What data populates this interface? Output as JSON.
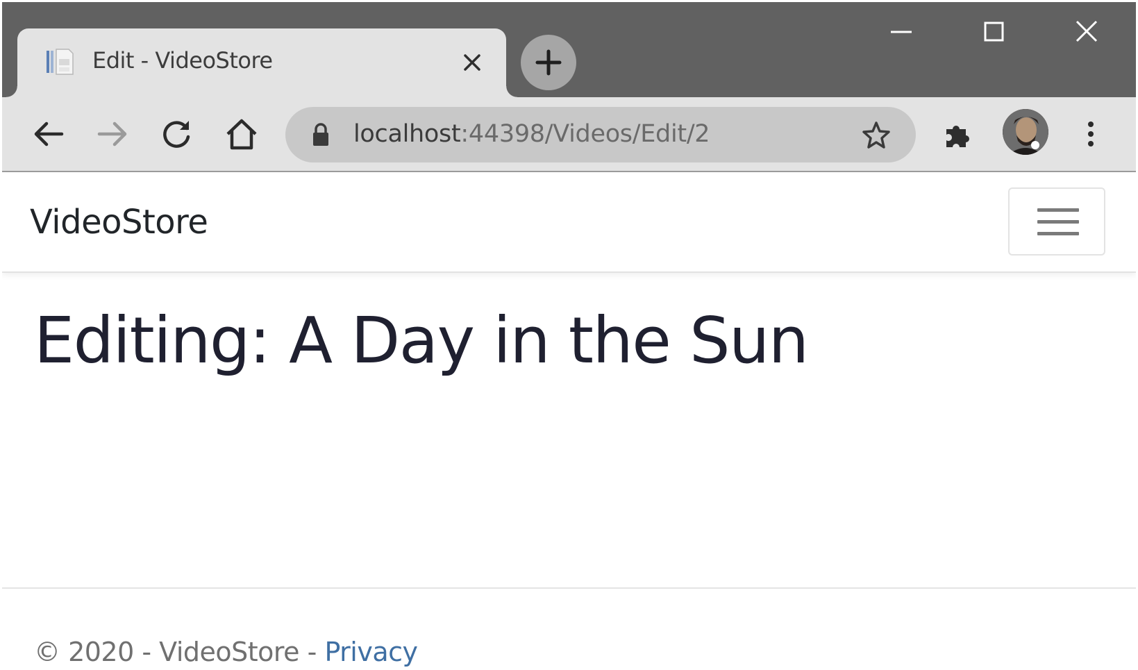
{
  "window": {
    "tab_title": "Edit - VideoStore"
  },
  "toolbar": {
    "url_host": "localhost",
    "url_path": ":44398/Videos/Edit/2"
  },
  "navbar": {
    "brand": "VideoStore"
  },
  "main": {
    "heading": "Editing: A Day in the Sun"
  },
  "footer": {
    "text": "© 2020 - VideoStore - ",
    "privacy_link": "Privacy"
  },
  "icons": {
    "tab_favicon": "document-icon",
    "tab_close": "close-icon",
    "new_tab": "plus-icon",
    "minimize": "minimize-icon",
    "maximize": "maximize-icon",
    "close_window": "close-icon",
    "back": "arrow-left-icon",
    "forward": "arrow-right-icon",
    "reload": "reload-icon",
    "home": "home-icon",
    "lock": "lock-icon",
    "bookmark": "star-icon",
    "extensions": "puzzle-icon",
    "profile": "avatar",
    "menu": "kebab-icon",
    "nav_toggle": "hamburger-icon"
  },
  "colors": {
    "tabstrip": "#616161",
    "toolbar": "#e3e3e3",
    "omnibox": "#c8c8c8",
    "link": "#3f6fa3",
    "heading": "#1f2030"
  }
}
